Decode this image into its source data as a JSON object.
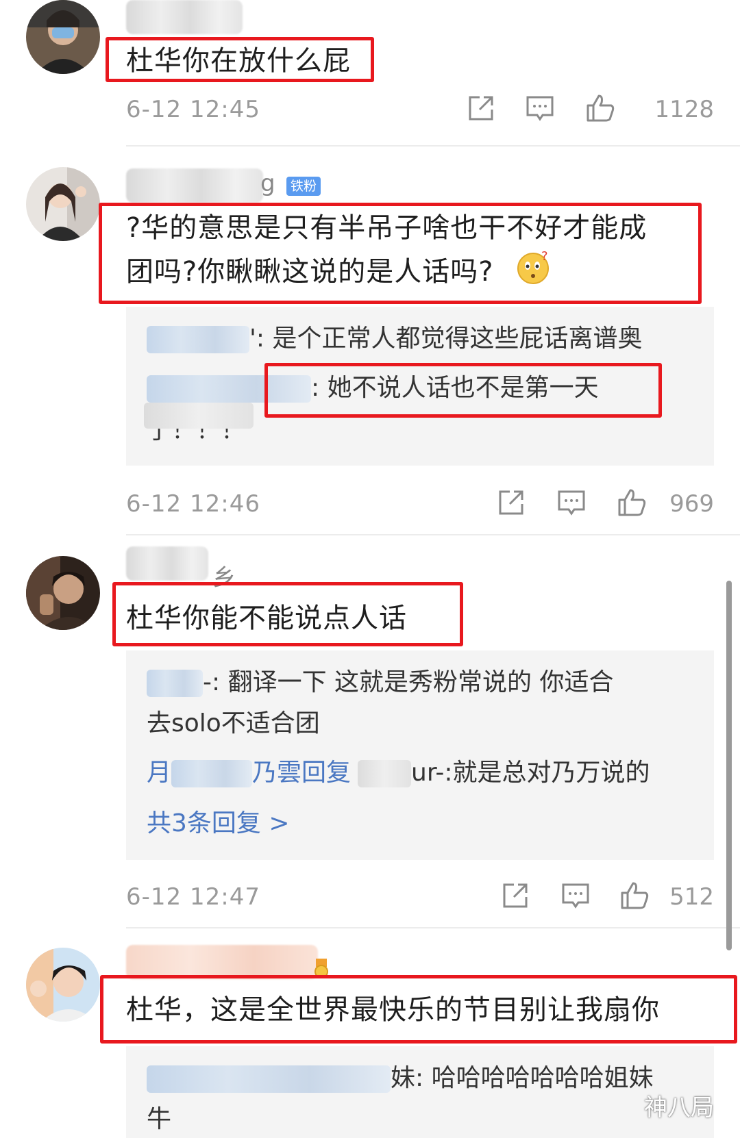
{
  "comments": [
    {
      "text": "杜华你在放什么屁",
      "time": "6-12 12:45",
      "likes": "1128"
    },
    {
      "name_tail": "g",
      "badge": "铁粉",
      "text_line1": "?华的意思是只有半吊子啥也干不好才能成",
      "text_line2": "团吗?你瞅瞅这说的是人话吗?",
      "emoji": "🤔",
      "replies": [
        {
          "suffix": "': 是个正常人都觉得这些屁话离谱奥"
        },
        {
          "suffix": ": 她不说人话也不是第一天"
        },
        {
          "suffix": "了！！！"
        }
      ],
      "time": "6-12 12:46",
      "likes": "969"
    },
    {
      "name_tail": "乡",
      "text": "杜华你能不能说点人话",
      "replies": [
        {
          "suffix": "-: 翻译一下 这就是秀粉常说的 你适合",
          "cont": "去solo不适合团"
        },
        {
          "prefix": "月",
          "mid": "乃雲回复",
          "suffix": "ur-:就是总对乃万说的"
        }
      ],
      "more_replies": "共3条回复 >",
      "time": "6-12 12:47",
      "likes": "512"
    },
    {
      "text": "杜华，这是全世界最快乐的节目别让我扇你",
      "replies": [
        {
          "suffix": "妹: 哈哈哈哈哈哈哈姐妹",
          "cont": "牛"
        }
      ]
    }
  ],
  "watermark": "神八局",
  "icons": [
    "share-icon",
    "comment-icon",
    "like-icon"
  ],
  "colors": {
    "highlight": "#e8181e",
    "link": "#4a77c2",
    "meta": "#9a9a9a",
    "badge": "#5a9bf0"
  }
}
